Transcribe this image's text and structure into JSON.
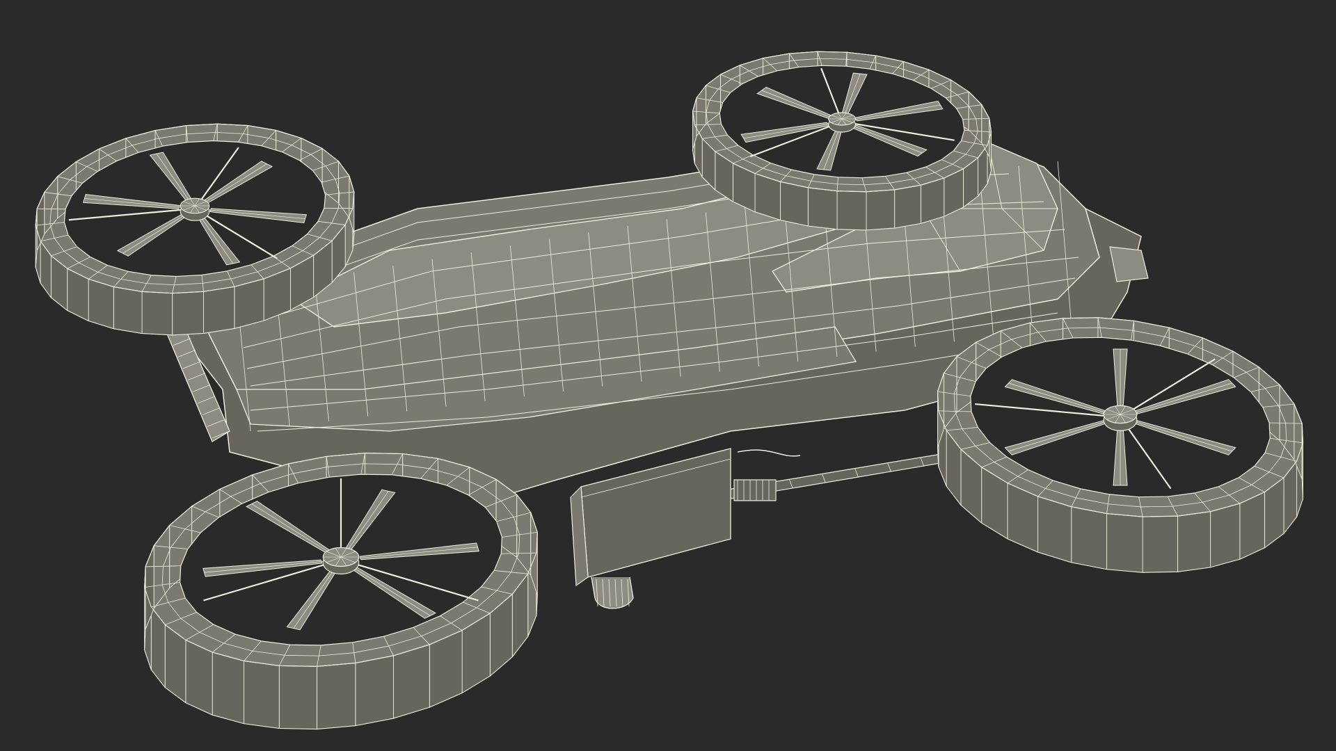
{
  "scene": {
    "background_color": "#2a2a2a",
    "model_fill_color": "#7a7a70",
    "model_shade_color": "#66665d",
    "model_light_color": "#8c8c82",
    "wire_color": "#eeeedd",
    "components": {
      "fuselage": "drone-fuselage",
      "rotors": [
        "rotor-front-left",
        "rotor-rear-left",
        "rotor-front-right",
        "rotor-rear-right"
      ],
      "payload": "payload-box",
      "skid": "landing-skid",
      "rod": "support-rod"
    }
  }
}
